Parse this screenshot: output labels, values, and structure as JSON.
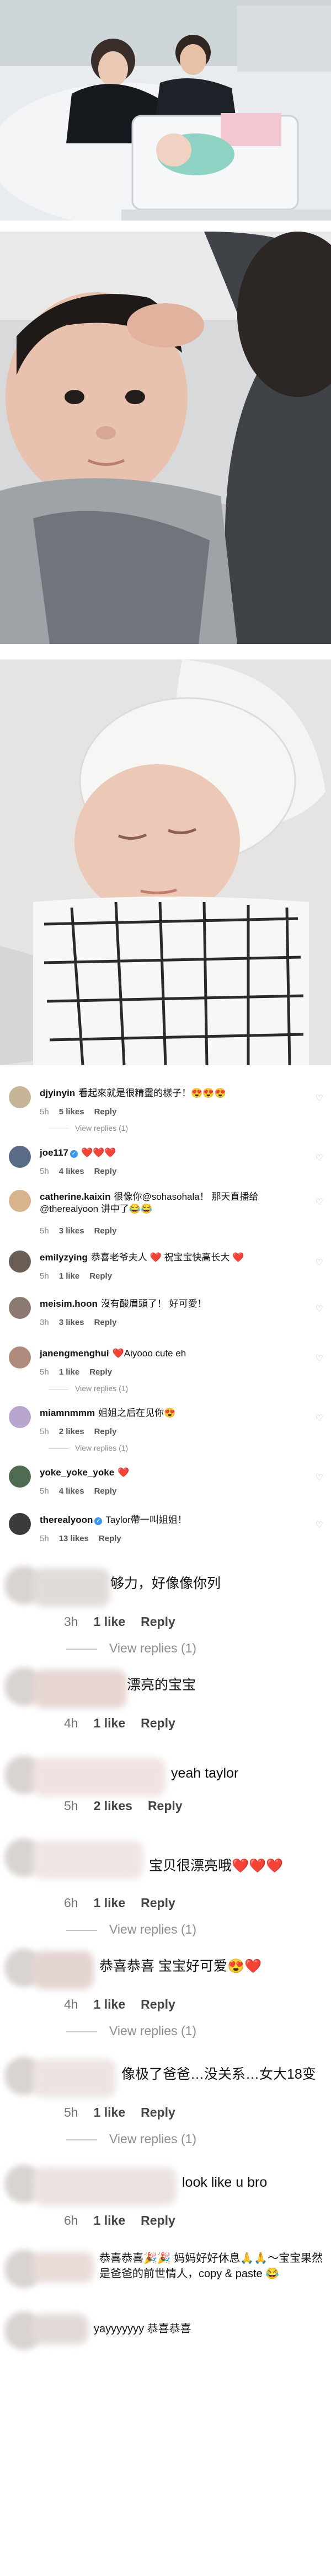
{
  "photos": [
    {
      "caption": "parents with newborn in hospital bed"
    },
    {
      "caption": "baby looking up, mother's hand on head"
    },
    {
      "caption": "swaddled baby sleeping in white hat"
    }
  ],
  "small_comments": [
    {
      "user": "djyinyin",
      "verified": false,
      "text": "看起來就是很精靈的樣子！😍😍😍",
      "time": "5h",
      "likes": "5 likes",
      "reply": "Reply",
      "view_replies": "View replies (1)",
      "avatar_color": "#c7b59a"
    },
    {
      "user": "joe117",
      "verified": true,
      "text": "❤️❤️❤️",
      "time": "5h",
      "likes": "4 likes",
      "reply": "Reply",
      "view_replies": "",
      "avatar_color": "#5a6b86"
    },
    {
      "user": "catherine.kaixin",
      "verified": false,
      "text": "很像你@sohasohala！ 那天直播给@therealyoon 讲中了😂😂",
      "time": "5h",
      "likes": "3 likes",
      "reply": "Reply",
      "view_replies": "",
      "avatar_color": "#d8b48e"
    },
    {
      "user": "emilyzying",
      "verified": false,
      "text": "恭喜老爷夫人 ❤️ 祝宝宝快高长大 ❤️",
      "time": "5h",
      "likes": "1 like",
      "reply": "Reply",
      "view_replies": "",
      "avatar_color": "#6a5e55"
    },
    {
      "user": "meisim.hoon",
      "verified": false,
      "text": "沒有酸眉頭了！ 好可愛！",
      "time": "3h",
      "likes": "3 likes",
      "reply": "Reply",
      "view_replies": "",
      "avatar_color": "#8a7a70"
    },
    {
      "user": "janengmenghui",
      "verified": false,
      "text": "❤️Aiyooo cute eh",
      "time": "5h",
      "likes": "1 like",
      "reply": "Reply",
      "view_replies": "View replies (1)",
      "avatar_color": "#b08a7c"
    },
    {
      "user": "miamnmmm",
      "verified": false,
      "text": "姐姐之后在见你😍",
      "time": "5h",
      "likes": "2 likes",
      "reply": "Reply",
      "view_replies": "View replies (1)",
      "avatar_color": "#b9a6cf"
    },
    {
      "user": "yoke_yoke_yoke",
      "verified": false,
      "text": "❤️",
      "time": "5h",
      "likes": "4 likes",
      "reply": "Reply",
      "view_replies": "",
      "avatar_color": "#4f6b52"
    },
    {
      "user": "therealyoon",
      "verified": true,
      "text": "Taylor帶一叫姐姐！",
      "time": "5h",
      "likes": "13 likes",
      "reply": "Reply",
      "view_replies": "",
      "avatar_color": "#3b3b3b"
    }
  ],
  "big_comments": [
    {
      "text": "够力，好像像你列",
      "time": "3h",
      "likes": "1 like",
      "reply": "Reply",
      "view_replies": "View replies (1)"
    },
    {
      "text": "漂亮的宝宝",
      "time": "4h",
      "likes": "1 like",
      "reply": "Reply",
      "view_replies": ""
    },
    {
      "text": "yeah taylor",
      "time": "5h",
      "likes": "2 likes",
      "reply": "Reply",
      "view_replies": ""
    },
    {
      "text": "宝贝很漂亮哦❤️❤️❤️",
      "time": "6h",
      "likes": "1 like",
      "reply": "Reply",
      "view_replies": "View replies (1)"
    },
    {
      "text": "恭喜恭喜 宝宝好可爱😍❤️",
      "time": "4h",
      "likes": "1 like",
      "reply": "Reply",
      "view_replies": "View replies (1)"
    },
    {
      "text": "像极了爸爸…没关系…女大18变",
      "time": "5h",
      "likes": "1 like",
      "reply": "Reply",
      "view_replies": "View replies (1)"
    },
    {
      "text": "look like u bro",
      "time": "6h",
      "likes": "1 like",
      "reply": "Reply",
      "view_replies": ""
    },
    {
      "text": "恭喜恭喜🎉🎉 妈妈好好休息🙏🙏～宝宝果然是爸爸的前世情人，copy & paste 😂",
      "time": "",
      "likes": "",
      "reply": "",
      "view_replies": ""
    },
    {
      "text": "yayyyyyyy 恭喜恭喜",
      "time": "",
      "likes": "",
      "reply": "",
      "view_replies": ""
    }
  ]
}
